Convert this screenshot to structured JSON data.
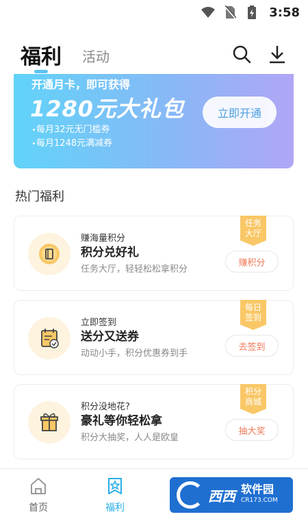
{
  "status_bar": {
    "time": "3:58",
    "icons": [
      "wifi-icon",
      "no-sim-icon",
      "battery-charging-icon"
    ]
  },
  "header": {
    "tabs": [
      {
        "label": "福利",
        "active": true
      },
      {
        "label": "活动",
        "active": false
      }
    ],
    "icons": [
      "search-icon",
      "download-icon"
    ]
  },
  "banner": {
    "headline": "开通月卡，即可获得",
    "big_text": "1280元大礼包",
    "line1": "每月32元无门槛券",
    "line2": "每月1248元满减券",
    "button": "立即开通"
  },
  "section": {
    "title": "热门福利"
  },
  "cards": [
    {
      "small": "赚海量积分",
      "title": "积分兑好礼",
      "desc": "任务大厅，轻轻松松拿积分",
      "ribbon_top": "任务",
      "ribbon_bottom": "大厅",
      "action": "赚积分",
      "icon": "coin-icon"
    },
    {
      "small": "立即签到",
      "title": "送分又送券",
      "desc": "动动小手，积分优惠券到手",
      "ribbon_top": "每日",
      "ribbon_bottom": "签到",
      "action": "去签到",
      "icon": "calendar-check-icon"
    },
    {
      "small": "积分没地花?",
      "title": "豪礼等你轻松拿",
      "desc": "积分大抽奖，人人是欧皇",
      "ribbon_top": "积分",
      "ribbon_bottom": "商城",
      "action": "抽大奖",
      "icon": "gift-icon"
    }
  ],
  "bottom_nav": [
    {
      "label": "首页",
      "active": false,
      "icon": "home-icon"
    },
    {
      "label": "福利",
      "active": true,
      "icon": "welfare-icon"
    }
  ],
  "watermark": {
    "brand": "西西",
    "name": "软件园",
    "sub": "CR173.COM"
  },
  "colors": {
    "accent": "#5cc3f2",
    "orange": "#ef7a5a",
    "ribbon": "#f9c766"
  }
}
